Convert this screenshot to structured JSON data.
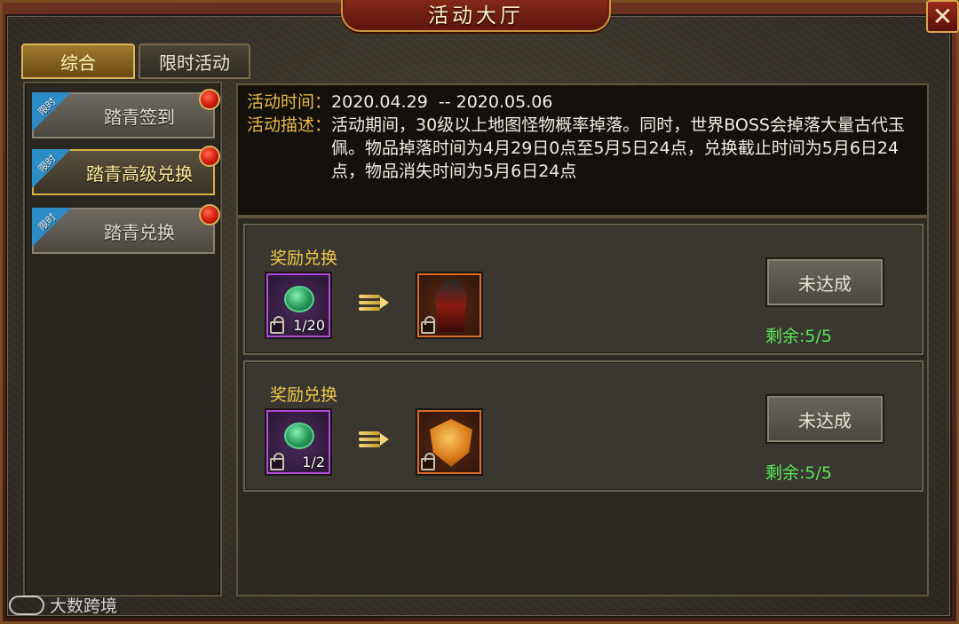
{
  "window": {
    "title": "活动大厅",
    "close_icon": "✕"
  },
  "tabs": [
    {
      "label": "综合",
      "active": true
    },
    {
      "label": "限时活动",
      "active": false
    }
  ],
  "sidebar": {
    "items": [
      {
        "label": "踏青签到",
        "badge": "限时",
        "selected": false,
        "red_dot": true
      },
      {
        "label": "踏青高级兑换",
        "badge": "限时",
        "selected": true,
        "red_dot": true
      },
      {
        "label": "踏青兑换",
        "badge": "限时",
        "selected": false,
        "red_dot": true
      }
    ]
  },
  "info": {
    "time_label": "活动时间：",
    "time_value": "2020.04.29  -- 2020.05.06",
    "desc_label": "活动描述：",
    "desc_value": "活动期间，30级以上地图怪物概率掉落。同时，世界BOSS会掉落大量古代玉佩。物品掉落时间为4月29日0点至5月5日24点，兑换截止时间为5月6日24点，物品消失时间为5月6日24点"
  },
  "rewards": [
    {
      "title": "奖励兑换",
      "cost_item": {
        "icon": "jade-pendant-icon",
        "count": "1/20",
        "quality_color": "#b04ad8"
      },
      "result_item": {
        "icon": "robe-icon",
        "quality_color": "#d86a2a"
      },
      "button_label": "未达成",
      "remaining": "剩余:5/5"
    },
    {
      "title": "奖励兑换",
      "cost_item": {
        "icon": "jade-pendant-icon",
        "count": "1/2",
        "quality_color": "#b04ad8"
      },
      "result_item": {
        "icon": "shield-icon",
        "quality_color": "#d86a2a"
      },
      "button_label": "未达成",
      "remaining": "剩余:5/5"
    }
  ],
  "watermark": {
    "text": "大数跨境"
  },
  "colors": {
    "accent_gold": "#e8b84a",
    "remaining_green": "#5ae85a",
    "red_dot": "#d01a0a",
    "ribbon_blue": "#2c8cc8"
  }
}
